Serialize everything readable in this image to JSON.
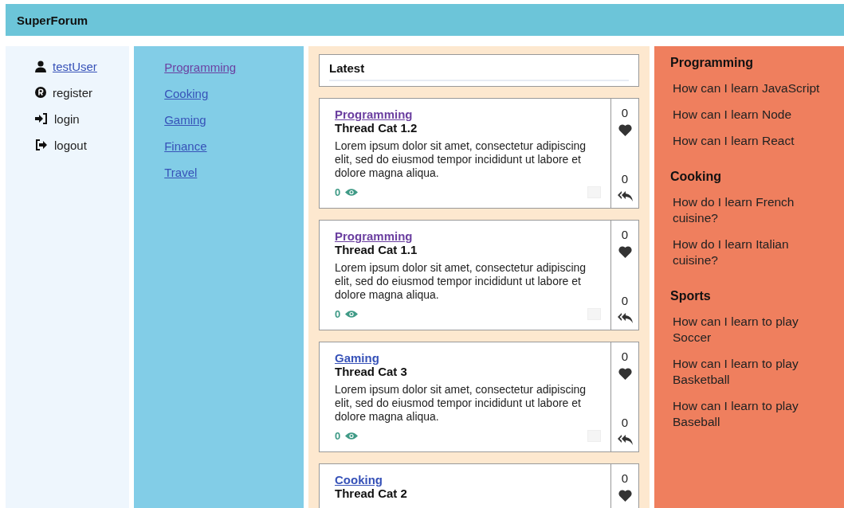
{
  "header": {
    "title": "SuperForum"
  },
  "user_menu": [
    {
      "kind": "user",
      "label": "testUser"
    },
    {
      "kind": "register",
      "label": "register"
    },
    {
      "kind": "login",
      "label": "login"
    },
    {
      "kind": "logout",
      "label": "logout"
    }
  ],
  "categories": [
    {
      "label": "Programming",
      "visited": true
    },
    {
      "label": "Cooking",
      "visited": false
    },
    {
      "label": "Gaming",
      "visited": false
    },
    {
      "label": "Finance",
      "visited": false
    },
    {
      "label": "Travel",
      "visited": false
    }
  ],
  "latest": {
    "title": "Latest"
  },
  "threads": [
    {
      "category": "Programming",
      "visited": true,
      "title": "Thread Cat 1.2",
      "body": "Lorem ipsum dolor sit amet, consectetur adipiscing elit, sed do eiusmod tempor incididunt ut labore et dolore magna aliqua.",
      "views": "0",
      "likes": "0",
      "replies": "0"
    },
    {
      "category": "Programming",
      "visited": true,
      "title": "Thread Cat 1.1",
      "body": "Lorem ipsum dolor sit amet, consectetur adipiscing elit, sed do eiusmod tempor incididunt ut labore et dolore magna aliqua.",
      "views": "0",
      "likes": "0",
      "replies": "0"
    },
    {
      "category": "Gaming",
      "visited": false,
      "title": "Thread Cat 3",
      "body": "Lorem ipsum dolor sit amet, consectetur adipiscing elit, sed do eiusmod tempor incididunt ut labore et dolore magna aliqua.",
      "views": "0",
      "likes": "0",
      "replies": "0"
    },
    {
      "category": "Cooking",
      "visited": false,
      "title": "Thread Cat 2",
      "likes": "0"
    }
  ],
  "top_threads": [
    {
      "category": "Programming",
      "threads": [
        "How can I learn JavaScript",
        "How can I learn Node",
        "How can I learn React"
      ]
    },
    {
      "category": "Cooking",
      "threads": [
        "How do I learn French cuisine?",
        "How do I learn Italian cuisine?"
      ]
    },
    {
      "category": "Sports",
      "threads": [
        "How can I learn to play Soccer",
        "How can I learn to play Basketball",
        "How can I learn to play Baseball"
      ]
    }
  ]
}
